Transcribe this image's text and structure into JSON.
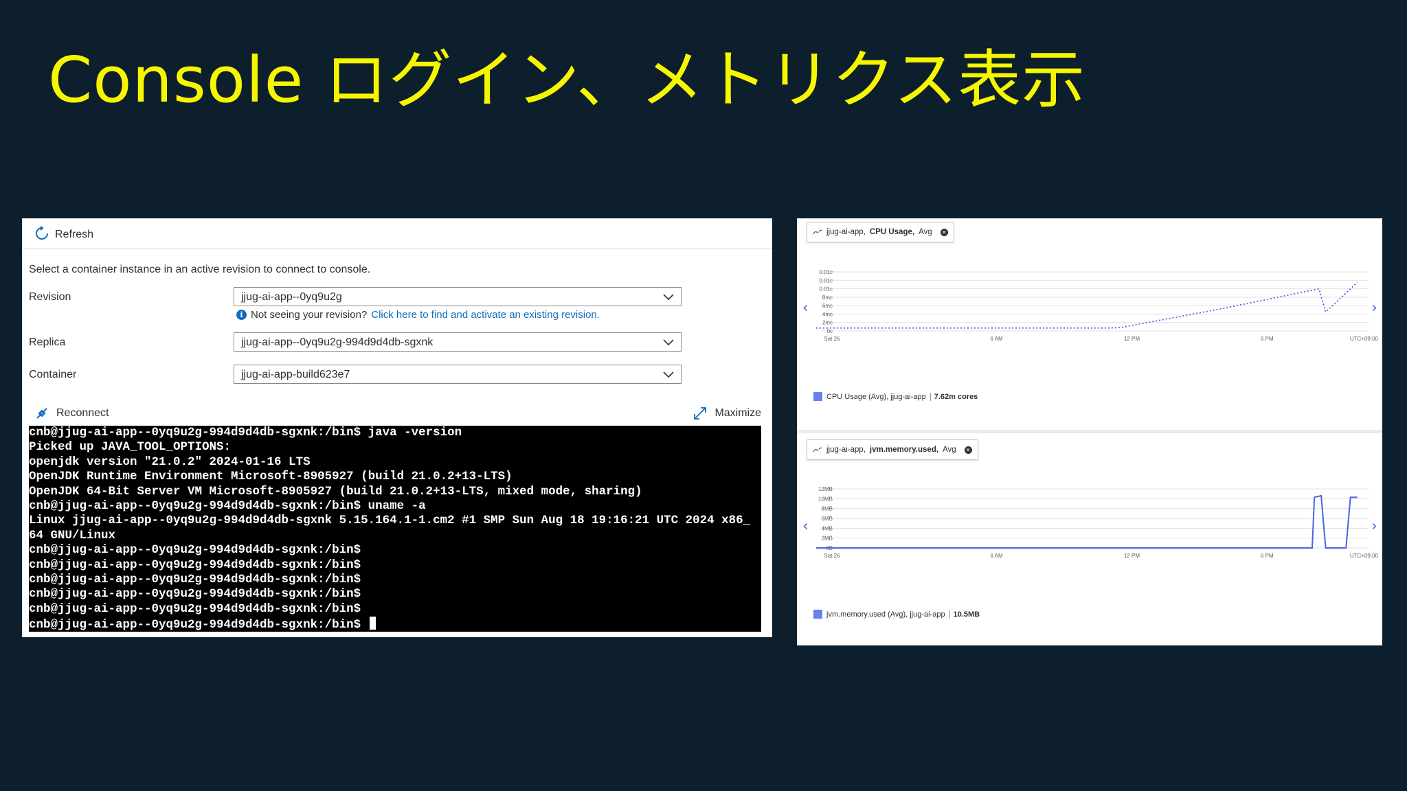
{
  "slide": {
    "title": "Console ログイン、メトリクス表示"
  },
  "console": {
    "refresh_label": "Refresh",
    "instruction": "Select a container instance in an active revision to connect to console.",
    "revision": {
      "label": "Revision",
      "value": "jjug-ai-app--0yq9u2g"
    },
    "help": {
      "text": "Not seeing your revision?",
      "link": "Click here to find and activate an existing revision."
    },
    "replica": {
      "label": "Replica",
      "value": "jjug-ai-app--0yq9u2g-994d9d4db-sgxnk"
    },
    "container": {
      "label": "Container",
      "value": "jjug-ai-app-build623e7"
    },
    "reconnect_label": "Reconnect",
    "maximize_label": "Maximize",
    "terminal_lines": [
      "cnb@jjug-ai-app--0yq9u2g-994d9d4db-sgxnk:/bin$ java -version",
      "Picked up JAVA_TOOL_OPTIONS:",
      "openjdk version \"21.0.2\" 2024-01-16 LTS",
      "OpenJDK Runtime Environment Microsoft-8905927 (build 21.0.2+13-LTS)",
      "OpenJDK 64-Bit Server VM Microsoft-8905927 (build 21.0.2+13-LTS, mixed mode, sharing)",
      "cnb@jjug-ai-app--0yq9u2g-994d9d4db-sgxnk:/bin$ uname -a",
      "Linux jjug-ai-app--0yq9u2g-994d9d4db-sgxnk 5.15.164.1-1.cm2 #1 SMP Sun Aug 18 19:16:21 UTC 2024 x86_",
      "64 GNU/Linux",
      "cnb@jjug-ai-app--0yq9u2g-994d9d4db-sgxnk:/bin$",
      "cnb@jjug-ai-app--0yq9u2g-994d9d4db-sgxnk:/bin$",
      "cnb@jjug-ai-app--0yq9u2g-994d9d4db-sgxnk:/bin$",
      "cnb@jjug-ai-app--0yq9u2g-994d9d4db-sgxnk:/bin$",
      "cnb@jjug-ai-app--0yq9u2g-994d9d4db-sgxnk:/bin$",
      "cnb@jjug-ai-app--0yq9u2g-994d9d4db-sgxnk:/bin$"
    ]
  },
  "metrics": {
    "cpu_tag": {
      "prefix": "jjug-ai-app,",
      "metric": "CPU Usage,",
      "agg": "Avg"
    },
    "cpu_legend": {
      "label": "CPU Usage (Avg), jjug-ai-app",
      "value": "7.62m cores"
    },
    "mem_tag": {
      "prefix": "jjug-ai-app,",
      "metric": "jvm.memory.used,",
      "agg": "Avg"
    },
    "mem_legend": {
      "label": "jvm.memory.used (Avg), jjug-ai-app",
      "value": "10.5MB"
    },
    "colors": {
      "series": "#4a64e0",
      "legend": "#6b7ff2",
      "grid": "#e1e1e1",
      "link": "#0f6cbd",
      "title": "#f6f600"
    }
  },
  "chart_data": [
    {
      "type": "line",
      "title": "",
      "y_ticks": [
        "0.01c",
        "0.01c",
        "0.01c",
        "8mc",
        "6mc",
        "4mc",
        "2mc",
        "0c"
      ],
      "x_ticks": [
        "Sat 26",
        "6 AM",
        "12 PM",
        "6 PM",
        "UTC+09:00"
      ],
      "ylim": [
        0,
        14
      ],
      "grid": true,
      "series": [
        {
          "name": "CPU Usage (Avg), jjug-ai-app",
          "style": "dotted",
          "x_hours": [
            -2,
            0,
            6,
            11,
            11.5,
            16.2,
            20.3,
            20.6,
            22
          ],
          "values": [
            0.7,
            0.7,
            0.7,
            0.7,
            0.8,
            5.5,
            10,
            4.5,
            11.5
          ]
        }
      ]
    },
    {
      "type": "line",
      "title": "",
      "y_ticks": [
        "12MB",
        "10MB",
        "8MB",
        "6MB",
        "4MB",
        "2MB",
        "0B"
      ],
      "x_ticks": [
        "Sat 26",
        "6 AM",
        "12 PM",
        "6 PM",
        "UTC+09:00"
      ],
      "ylim": [
        0,
        12
      ],
      "grid": true,
      "series": [
        {
          "name": "jvm.memory.used (Avg), jjug-ai-app",
          "style": "solid",
          "x_hours": [
            -2,
            0,
            6,
            12,
            18,
            20,
            20.1,
            20.4,
            20.6,
            21.5,
            21.7,
            22
          ],
          "values": [
            0,
            0,
            0,
            0,
            0,
            0,
            10.3,
            10.6,
            0,
            0,
            10.3,
            10.3
          ]
        }
      ]
    }
  ]
}
